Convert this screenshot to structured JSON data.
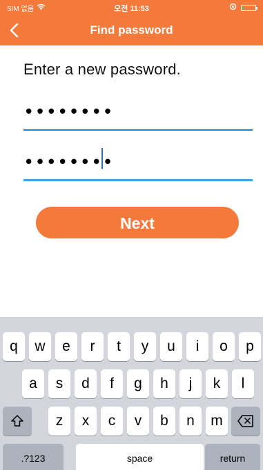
{
  "status_bar": {
    "carrier": "SIM 없음",
    "time": "오전 11:53",
    "battery_level": 0.12,
    "icons": [
      "wifi-icon",
      "rotation-lock-icon",
      "battery-icon"
    ]
  },
  "nav": {
    "title": "Find password",
    "back_icon": "chevron-left-icon"
  },
  "form": {
    "prompt": "Enter a new password.",
    "password_1": "••••••••",
    "password_2": "••••••••"
  },
  "next_label": "Next",
  "keyboard": {
    "row1": [
      "q",
      "w",
      "e",
      "r",
      "t",
      "y",
      "u",
      "i",
      "o",
      "p"
    ],
    "row2": [
      "a",
      "s",
      "d",
      "f",
      "g",
      "h",
      "j",
      "k",
      "l"
    ],
    "row3": [
      "z",
      "x",
      "c",
      "v",
      "b",
      "n",
      "m"
    ],
    "shift_icon": "shift-icon",
    "delete_icon": "delete-icon",
    "numbers_label": ".?123",
    "space_label": "space",
    "return_label": "return"
  },
  "colors": {
    "accent": "#f47a3c",
    "field_underline": "#3ea3e2",
    "keyboard_bg": "#d2d5db"
  }
}
